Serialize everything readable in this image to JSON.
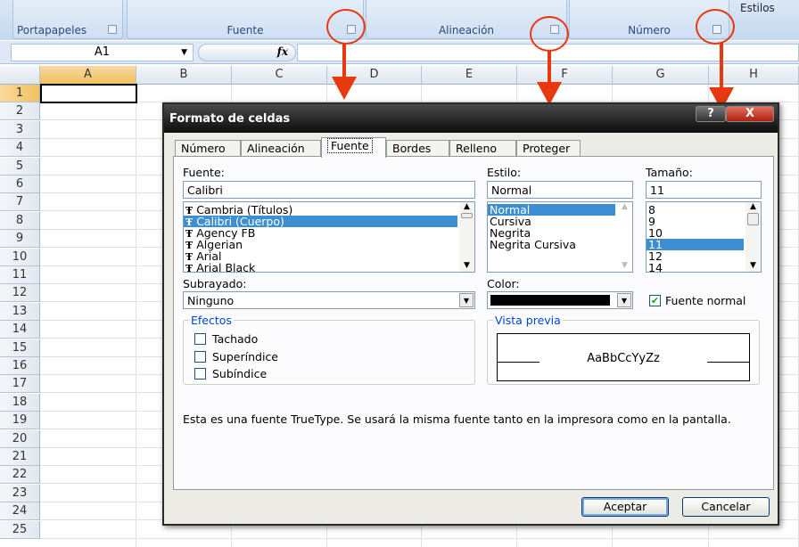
{
  "ribbon": {
    "groups": [
      {
        "label": "Portapapeles"
      },
      {
        "label": "Fuente"
      },
      {
        "label": "Alineación"
      },
      {
        "label": "Número"
      }
    ],
    "partial": "Estilos"
  },
  "formula_bar": {
    "name_box": "A1",
    "fx": "fx"
  },
  "columns": [
    "A",
    "B",
    "C",
    "D",
    "E",
    "F",
    "G",
    "H"
  ],
  "rows": [
    "1",
    "2",
    "3",
    "4",
    "5",
    "6",
    "7",
    "8",
    "9",
    "10",
    "11",
    "12",
    "13",
    "14",
    "15",
    "16",
    "17",
    "18",
    "19",
    "20",
    "21",
    "22",
    "23",
    "24",
    "25"
  ],
  "dialog": {
    "title": "Formato de celdas",
    "help": "?",
    "close": "X",
    "tabs": [
      "Número",
      "Alineación",
      "Fuente",
      "Bordes",
      "Relleno",
      "Proteger"
    ],
    "font": {
      "label": "Fuente:",
      "value": "Calibri",
      "items": [
        "Cambria (Títulos)",
        "Calibri (Cuerpo)",
        "Agency FB",
        "Algerian",
        "Arial",
        "Arial Black"
      ],
      "selected": 1
    },
    "style": {
      "label": "Estilo:",
      "value": "Normal",
      "items": [
        "Normal",
        "Cursiva",
        "Negrita",
        "Negrita Cursiva"
      ],
      "selected": 0
    },
    "size": {
      "label": "Tamaño:",
      "value": "11",
      "items": [
        "8",
        "9",
        "10",
        "11",
        "12",
        "14"
      ],
      "selected": 3
    },
    "underline": {
      "label": "Subrayado:",
      "value": "Ninguno"
    },
    "color": {
      "label": "Color:",
      "value": "#000000"
    },
    "normal_font": {
      "label": "Fuente normal",
      "checked": true
    },
    "effects": {
      "label": "Efectos",
      "items": [
        {
          "label": "Tachado",
          "checked": false
        },
        {
          "label": "Superíndice",
          "checked": false
        },
        {
          "label": "Subíndice",
          "checked": false
        }
      ]
    },
    "preview": {
      "label": "Vista previa",
      "text": "AaBbCcYyZz"
    },
    "note": "Esta es una fuente TrueType. Se usará la misma fuente tanto en la impresora como en la pantalla.",
    "ok": "Aceptar",
    "cancel": "Cancelar"
  },
  "colors": {
    "accent": "#e8380d",
    "selection": "#3d8fd1"
  }
}
